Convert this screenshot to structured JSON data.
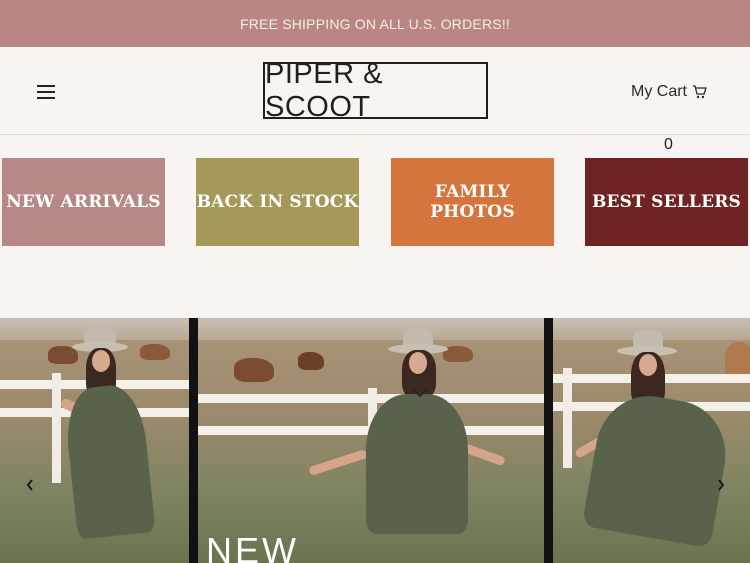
{
  "announcement": "FREE SHIPPING ON ALL U.S. ORDERS!!",
  "header": {
    "logo": "PIPER & SCOOT",
    "cart_label": "My Cart",
    "cart_count": "0"
  },
  "tiles": [
    {
      "label": "NEW ARRIVALS",
      "color": "#b68886"
    },
    {
      "label": "BACK IN STOCK",
      "color": "#a4995a"
    },
    {
      "label": "FAMILY PHOTOS",
      "color": "#d5753e"
    },
    {
      "label": "BEST SELLERS",
      "color": "#6f2423"
    }
  ],
  "hero": {
    "text": "NEW"
  },
  "icons": {
    "menu": "hamburger-menu-icon",
    "cart": "shopping-cart-icon",
    "prev": "chevron-left-icon",
    "next": "chevron-right-icon",
    "down": "chevron-down-icon"
  }
}
